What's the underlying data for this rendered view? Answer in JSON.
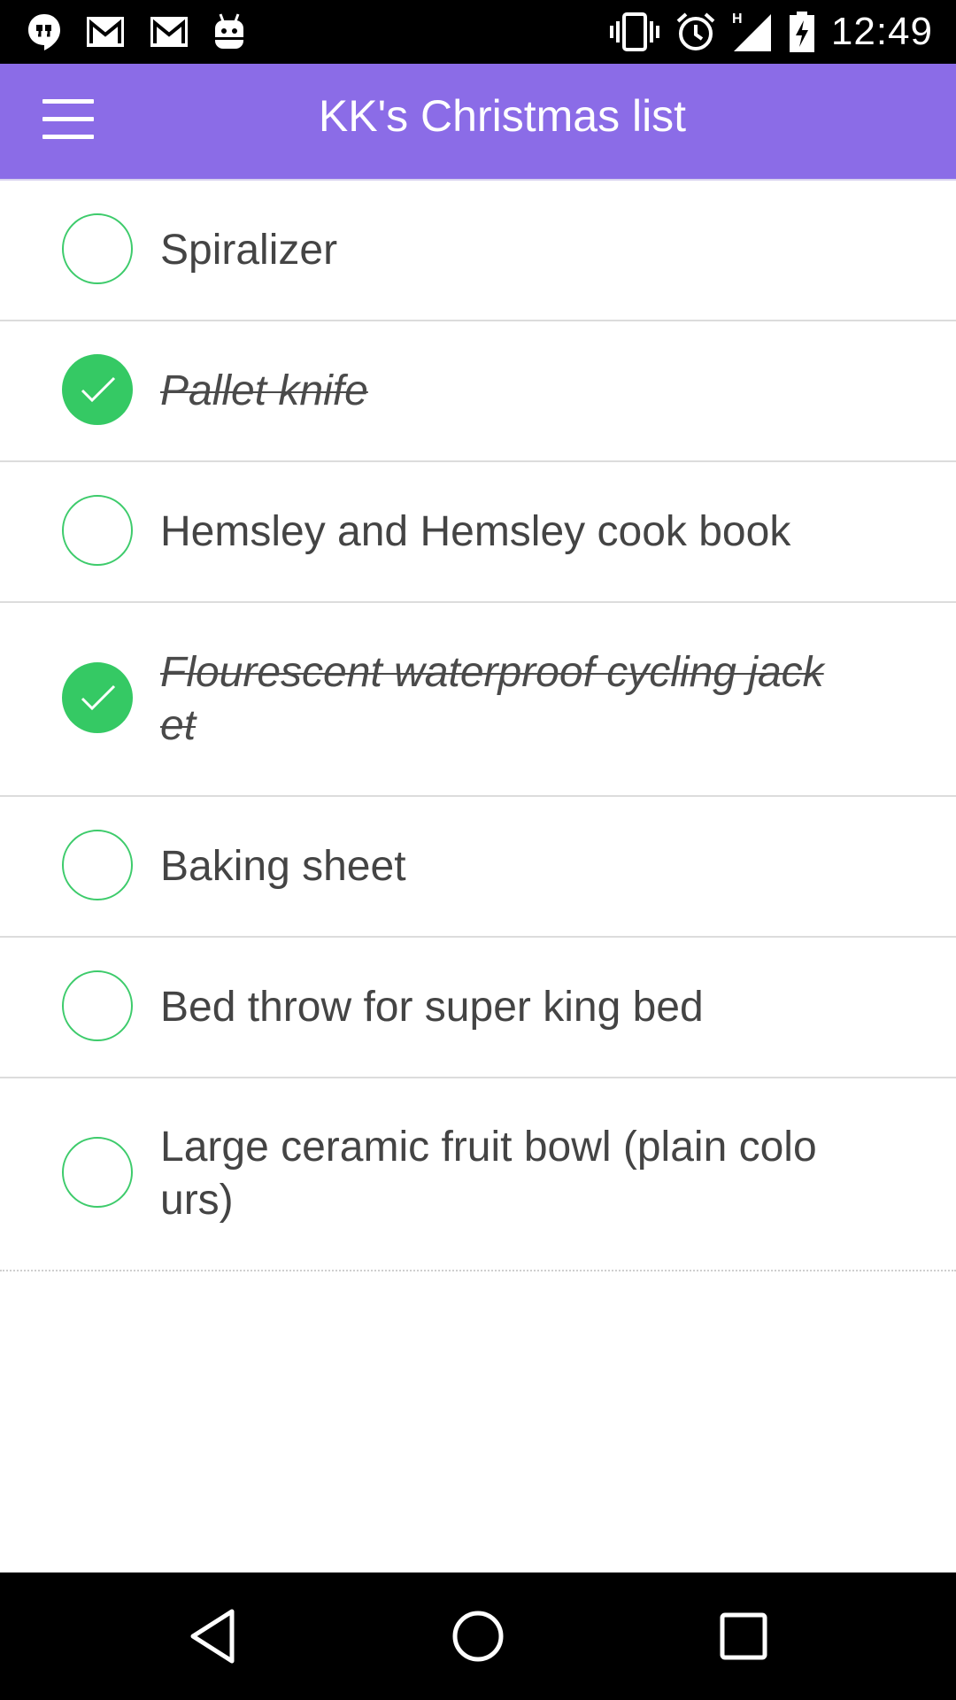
{
  "status_bar": {
    "time": "12:49",
    "left_icons": [
      "hangouts-icon",
      "gmail-icon",
      "gmail-icon",
      "android-icon"
    ],
    "right_icons": [
      "vibrate-icon",
      "alarm-icon",
      "signal-h-icon",
      "battery-charging-icon"
    ]
  },
  "app_bar": {
    "title": "KK's Christmas list",
    "menu_icon": "hamburger-menu-icon",
    "background": "#8B6CE7"
  },
  "colors": {
    "accent_green": "#35C964",
    "text": "#444444"
  },
  "items": [
    {
      "label": "Spiralizer",
      "checked": false
    },
    {
      "label": "Pallet knife",
      "checked": true
    },
    {
      "label": "Hemsley and Hemsley cook book",
      "checked": false
    },
    {
      "label": "Flourescent waterproof cycling jack",
      "label_line2": "et",
      "checked": true
    },
    {
      "label": "Baking sheet",
      "checked": false
    },
    {
      "label": "Bed throw for super king bed",
      "checked": false
    },
    {
      "label": "Large ceramic fruit bowl (plain colo",
      "label_line2": "urs)",
      "checked": false
    }
  ],
  "nav_bar": {
    "buttons": [
      "back-icon",
      "home-icon",
      "recents-icon"
    ]
  }
}
